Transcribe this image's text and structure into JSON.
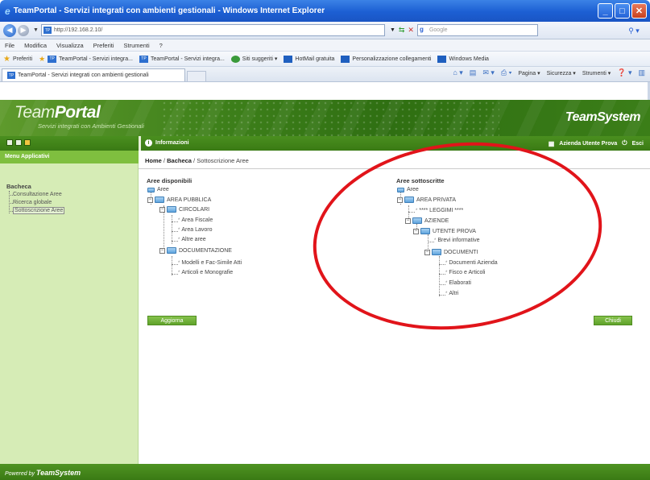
{
  "window": {
    "title": "TeamPortal - Servizi integrati con ambienti gestionali - Windows Internet Explorer",
    "buttons": [
      "_",
      "□",
      "✕"
    ]
  },
  "address_bar": {
    "url": "http://192.168.2.10/",
    "search_placeholder": "Google"
  },
  "menu": [
    "File",
    "Modifica",
    "Visualizza",
    "Preferiti",
    "Strumenti",
    "?"
  ],
  "favorites": {
    "label": "Preferiti",
    "items": [
      "TeamPortal - Servizi integra...",
      "TeamPortal - Servizi integra...",
      "Siti suggeriti ▾",
      "HotMail gratuita",
      "Personalizzazione collegamenti",
      "Windows Media"
    ]
  },
  "tab": {
    "label": "TeamPortal - Servizi integrati con ambienti gestionali"
  },
  "command_bar": [
    "Pagina ▾",
    "Sicurezza ▾",
    "Strumenti ▾"
  ],
  "header": {
    "logo_light": "Team",
    "logo_bold": "Portal",
    "subtitle": "Servizi integrati con Ambienti Gestionali",
    "brand": "TeamSystem"
  },
  "nav": {
    "info_label": "Informazioni",
    "company": "Azienda Utente Prova",
    "exit": "Esci"
  },
  "sidebar": {
    "title": "Menu Applicativi",
    "section": "Bacheca",
    "items": [
      "Consultazione Aree",
      "Ricerca globale",
      "Sottoscrizione Aree"
    ]
  },
  "breadcrumb": {
    "home": "Home",
    "sep1": " / ",
    "section": "Bacheca",
    "sep2": " / ",
    "page": "Sottoscrizione Aree"
  },
  "left_panel": {
    "title": "Aree disponibili",
    "root": "Aree",
    "nodes": [
      "AREA PUBBLICA",
      "CIRCOLARI",
      "Area Fiscale",
      "Area Lavoro",
      "Altre aree",
      "DOCUMENTAZIONE",
      "Modelli e Fac-Simile Atti",
      "Articoli e Monografie"
    ]
  },
  "right_panel": {
    "title": "Aree sottoscritte",
    "root": "Aree",
    "nodes": [
      "AREA PRIVATA",
      "**** LEGGIMI ****",
      "AZIENDE",
      "UTENTE PROVA",
      "Brevi informative",
      "DOCUMENTI",
      "Documenti Azienda",
      "Fisco e Articoli",
      "Elaborati",
      "Altri"
    ]
  },
  "buttons": {
    "update": "Aggiorna",
    "close": "Chiudi"
  },
  "footer": {
    "powered": "Powered by ",
    "brand": "TeamSystem"
  },
  "colors": {
    "primary_green": "#3a7a14",
    "sidebar_green": "#d6ecb6",
    "highlight_red": "#e1141a"
  }
}
